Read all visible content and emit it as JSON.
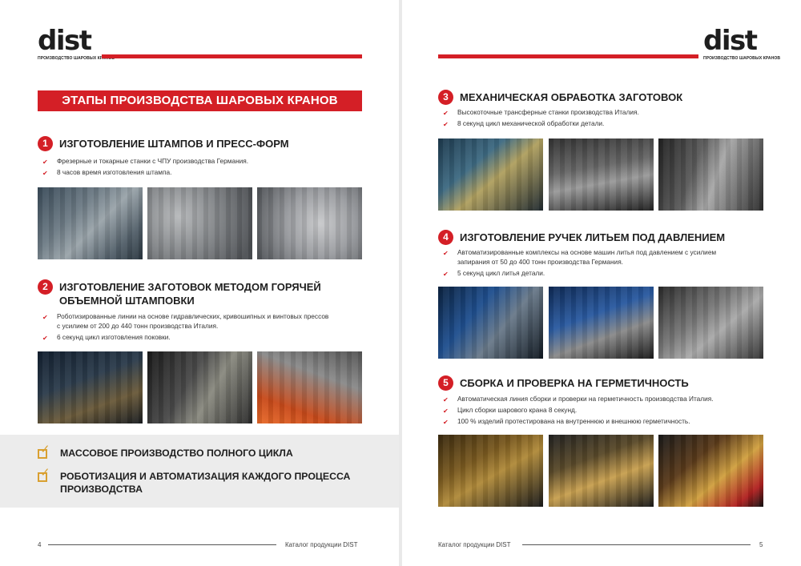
{
  "brand": {
    "logo_word": "dist",
    "logo_tagline": "ПРОИЗВОДСТВО ШАРОВЫХ КРАНОВ"
  },
  "left_page": {
    "section_title": "ЭТАПЫ ПРОИЗВОДСТВА ШАРОВЫХ КРАНОВ",
    "steps": [
      {
        "number": "1",
        "title": "ИЗГОТОВЛЕНИЕ ШТАМПОВ И ПРЕСС-ФОРМ",
        "bullets": [
          "Фрезерные  и токарные станки с ЧПУ производства Германия.",
          "8 часов время изготовления штампа."
        ]
      },
      {
        "number": "2",
        "title_line1": "ИЗГОТОВЛЕНИЕ ЗАГОТОВОК МЕТОДОМ ГОРЯЧЕЙ",
        "title_line2": "ОБЪЕМНОЙ ШТАМПОВКИ",
        "bullets": [
          "Роботизированные линии на основе гидравлических, кривошипных и винтовых прессов",
          "с усилием от 200 до 440 тонн производства Италия.",
          "6 секунд цикл изготовления поковки."
        ]
      }
    ],
    "summary": [
      {
        "text": "МАССОВОЕ ПРОИЗВОДСТВО ПОЛНОГО ЦИКЛА"
      },
      {
        "line1": "РОБОТИЗАЦИЯ И АВТОМАТИЗАЦИЯ КАЖДОГО ПРОЦЕССА",
        "line2": "ПРОИЗВОДСТВА"
      }
    ],
    "footer": {
      "page_number": "4",
      "catalog": "Каталог продукции DIST"
    }
  },
  "right_page": {
    "steps": [
      {
        "number": "3",
        "title": "МЕХАНИЧЕСКАЯ ОБРАБОТКА ЗАГОТОВОК",
        "bullets": [
          "Высокоточные трансферные станки производства Италия.",
          "8 секунд цикл механической обработки детали."
        ]
      },
      {
        "number": "4",
        "title": "ИЗГОТОВЛЕНИЕ РУЧЕК ЛИТЬЕМ ПОД ДАВЛЕНИЕМ",
        "bullets": [
          "Автоматизированные комплексы на основе машин литья под давлением с усилием",
          "запирания от 50 до 400 тонн производства Германия.",
          "5 секунд цикл литья детали."
        ]
      },
      {
        "number": "5",
        "title": "СБОРКА И ПРОВЕРКА НА ГЕРМЕТИЧНОСТЬ",
        "bullets": [
          "Автоматическая линия сборки и проверки на герметичность производства Италия.",
          "Цикл сборки шарового крана 8 секунд.",
          "100 % изделий протестирована на внутреннюю и внешнюю герметичность."
        ]
      }
    ],
    "footer": {
      "page_number": "5",
      "catalog": "Каталог продукции DIST"
    }
  },
  "colors": {
    "accent_red": "#d41f26",
    "check_gold": "#d9a030",
    "summary_bg": "#ececec"
  },
  "icons": {
    "bullet": "check-icon",
    "summary": "checkbox-icon"
  }
}
